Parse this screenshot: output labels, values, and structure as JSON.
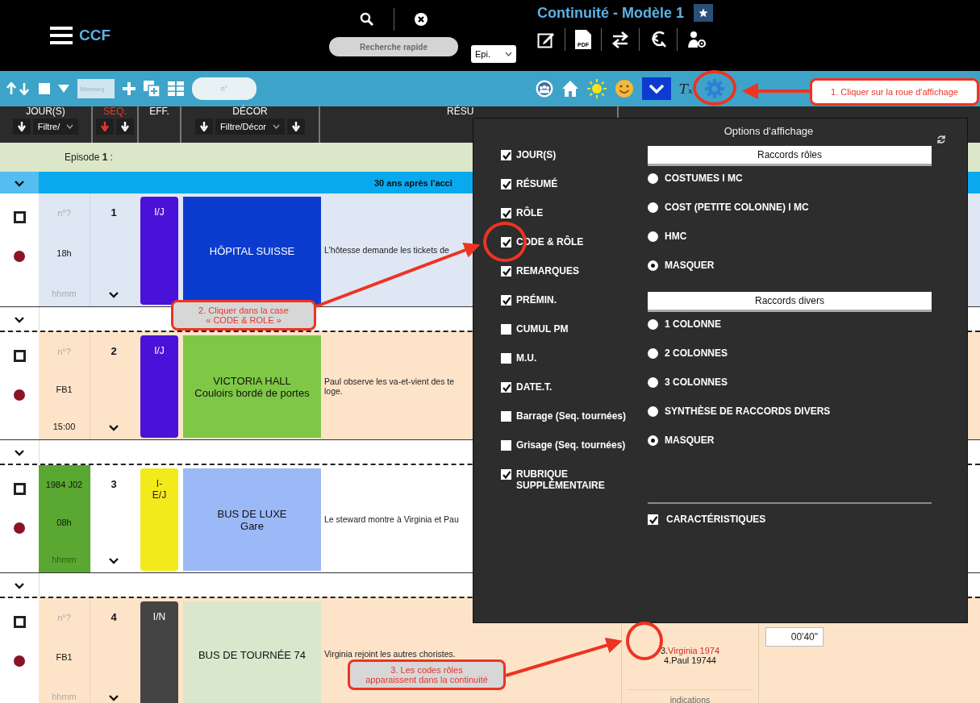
{
  "topbar": {
    "app_name": "CCF",
    "search_placeholder": "Recherche rapide",
    "episode_select": "Epi.",
    "title": "Continuité - Modèle 1",
    "pdf_label": "PDF"
  },
  "toolbar": {
    "select_all_checked": false,
    "count_placeholder": "Nbreseq",
    "number_placeholder": "n°",
    "clear_format_glyph": "Tₓ"
  },
  "header": [
    {
      "kind": "filter",
      "label": "JOUR(S)",
      "filter": "Filtre/",
      "active": false
    },
    {
      "kind": "sort",
      "label": "SÉQ.",
      "active": true
    },
    {
      "kind": "plain",
      "label": "EFF.",
      "active": false
    },
    {
      "kind": "filter",
      "label": "DÉCOR",
      "filter": "Filtre/Décor",
      "active": false
    },
    {
      "kind": "plain",
      "label": "RÉSU",
      "active": false
    }
  ],
  "rows": [
    {
      "kind": "episode",
      "label": "Episode **1** :"
    },
    {
      "kind": "section",
      "title": "30 ans après l'acci"
    },
    {
      "kind": "scene",
      "color": "#dfe7f4",
      "checked": false,
      "day": {
        "number": "n°?",
        "number_empty": true,
        "time": "18h",
        "hour": "hhmm",
        "hour_empty": true
      },
      "seq": "1",
      "effect": {
        "label": "I/J",
        "color": "#4a12d8"
      },
      "set": {
        "lines": [
          "HÔPITAL SUISSE"
        ],
        "color": "#0b3ccf"
      },
      "summary": [
        "L'hôtesse demande les tickets de"
      ]
    },
    {
      "kind": "spacer"
    },
    {
      "kind": "scene",
      "color": "#fde4c9",
      "checked": false,
      "day": {
        "number": "n°?",
        "number_empty": true,
        "time": "FB1",
        "hour": "15:00",
        "hour_empty": false
      },
      "seq": "2",
      "effect": {
        "label": "I/J",
        "color": "#4a12d8"
      },
      "set": {
        "lines": [
          "VICTORIA HALL",
          "Couloirs bordé de portes"
        ],
        "color": "#7fc846"
      },
      "summary": [
        "Paul observe les va-et-vient des te",
        "loge."
      ]
    },
    {
      "kind": "spacer"
    },
    {
      "kind": "scene",
      "color": "#ffffff",
      "checked": false,
      "day": {
        "number": "1984 J02",
        "number_empty": false,
        "time": "08h",
        "hour": "hhmm",
        "hour_empty": true,
        "color": "#5aa832"
      },
      "seq": "3",
      "effect": {
        "label": "I-\nE/J",
        "color": "#f2ea1a"
      },
      "set": {
        "lines": [
          "BUS DE LUXE",
          "Gare"
        ],
        "color": "#9bb9f7"
      },
      "summary": [
        "Le steward montre à Virginia et Pau"
      ]
    },
    {
      "kind": "spacer"
    },
    {
      "kind": "scene",
      "color": "#fde4c9",
      "checked": false,
      "day": {
        "number": "n°?",
        "number_empty": true,
        "time": "FB1",
        "hour": "hhmm",
        "hour_empty": true
      },
      "seq": "4",
      "effect": {
        "label": "I/N",
        "color": "#444444"
      },
      "set": {
        "lines": [
          "BUS DE TOURNÉE 74"
        ],
        "color": "#d9e7cc"
      },
      "summary": [
        "Virginia rejoint les autres choristes."
      ],
      "roles": {
        "codes": [
          {
            "code": "3.",
            "name": "Virginia 1974",
            "highlight": true
          },
          {
            "code": "4.",
            "name": "Paul 19744",
            "highlight": false
          }
        ],
        "note": "indications"
      },
      "premin": "00'40\""
    }
  ],
  "popup": {
    "title": "Options d'affichage",
    "columns": [
      {
        "label": "JOUR(S)",
        "checked": true
      },
      {
        "label": "RÉSUMÉ",
        "checked": true
      },
      {
        "label": "RÔLE",
        "checked": true
      },
      {
        "label": "CODE & RÔLE",
        "checked": true
      },
      {
        "label": "REMARQUES",
        "checked": true
      },
      {
        "label": "PRÉMIN.",
        "checked": true
      },
      {
        "label": "CUMUL PM",
        "checked": false
      },
      {
        "label": "M.U.",
        "checked": false
      },
      {
        "label": "DATE.T.",
        "checked": true
      },
      {
        "label": "Barrage (Seq. tournées)",
        "checked": false
      },
      {
        "label": "Grisage (Seq. tournées)",
        "checked": false
      },
      {
        "label": "RUBRIQUE SUPPLÉMENTAIRE",
        "checked": true
      }
    ],
    "groups": [
      {
        "title": "Raccords rôles",
        "options": [
          {
            "label": "COSTUMES I MC",
            "selected": false
          },
          {
            "label": "COST (PETITE COLONNE) I MC",
            "selected": false
          },
          {
            "label": "HMC",
            "selected": false
          },
          {
            "label": "MASQUER",
            "selected": true
          }
        ]
      },
      {
        "title": "Raccords divers",
        "options": [
          {
            "label": "1 COLONNE",
            "selected": false
          },
          {
            "label": "2 COLONNES",
            "selected": false
          },
          {
            "label": "3 COLONNES",
            "selected": false
          },
          {
            "label": "SYNTHÈSE DE RACCORDS DIVERS",
            "selected": false
          },
          {
            "label": "MASQUER",
            "selected": true
          }
        ]
      }
    ],
    "extra": {
      "label": "CARACTÉRISTIQUES",
      "checked": true
    }
  },
  "annotations": [
    {
      "kind": "light",
      "text": "1. Cliquer sur la roue d'affichage"
    },
    {
      "kind": "grey",
      "text": "2. Cliquer dans la case\n« CODE & ROLE »"
    },
    {
      "kind": "grey",
      "text": "3. Les codes rôles\napparaissent dans la continuité"
    }
  ]
}
